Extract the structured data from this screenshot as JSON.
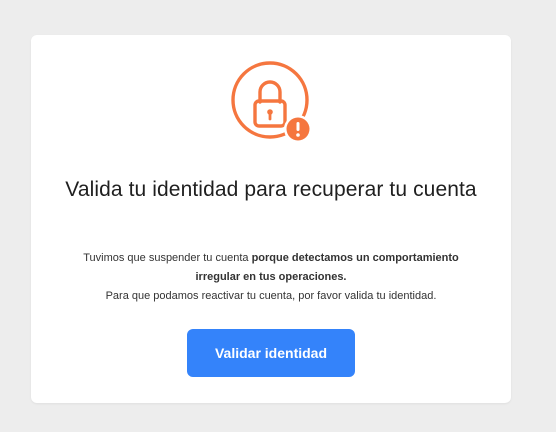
{
  "card": {
    "icon": "lock-warning-icon",
    "accent_color": "#f5763f",
    "title": "Valida tu identidad para recuperar tu cuenta",
    "message": {
      "line1_plain": "Tuvimos que suspender tu cuenta",
      "line1_bold": "porque detectamos un comportamiento",
      "line2_bold": "irregular en tus operaciones.",
      "line3": "Para que podamos reactivar tu cuenta, por favor valida tu identidad."
    },
    "button_label": "Validar identidad",
    "button_color": "#3483fa"
  }
}
